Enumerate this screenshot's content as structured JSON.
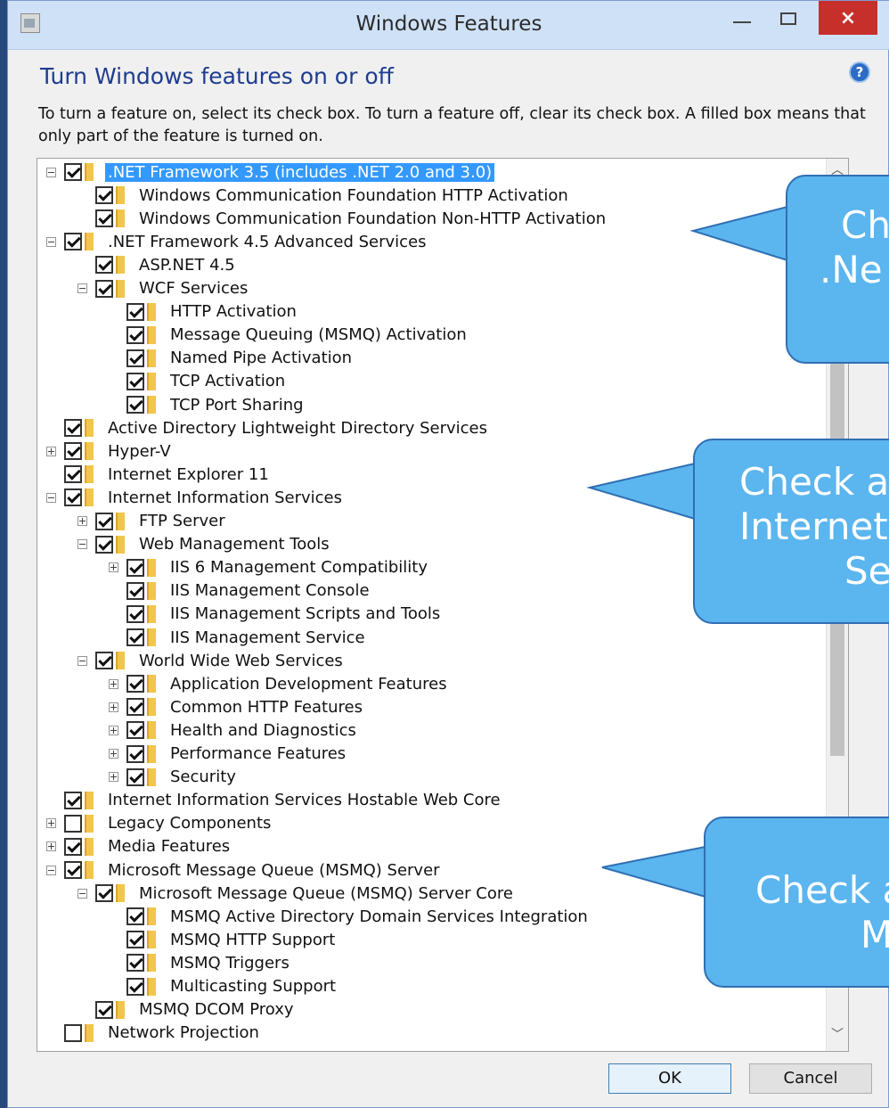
{
  "window": {
    "title": "Windows Features",
    "close_glyph": "×"
  },
  "heading": "Turn Windows features on or off",
  "help_glyph": "?",
  "description": "To turn a feature on, select its check box. To turn a feature off, clear its check box. A filled box means that only part of the feature is turned on.",
  "features": [
    {
      "label": ".NET Framework 3.5 (includes .NET 2.0 and 3.0)",
      "level": 0,
      "expander": "minus",
      "checked": true,
      "selected": true
    },
    {
      "label": "Windows Communication Foundation HTTP Activation",
      "level": 1,
      "expander": "none",
      "checked": true
    },
    {
      "label": "Windows Communication Foundation Non-HTTP Activation",
      "level": 1,
      "expander": "none",
      "checked": true
    },
    {
      "label": ".NET Framework 4.5 Advanced Services",
      "level": 0,
      "expander": "minus",
      "checked": true
    },
    {
      "label": "ASP.NET 4.5",
      "level": 1,
      "expander": "none",
      "checked": true
    },
    {
      "label": "WCF Services",
      "level": 1,
      "expander": "minus",
      "checked": true
    },
    {
      "label": "HTTP Activation",
      "level": 2,
      "expander": "none",
      "checked": true
    },
    {
      "label": "Message Queuing (MSMQ) Activation",
      "level": 2,
      "expander": "none",
      "checked": true
    },
    {
      "label": "Named Pipe Activation",
      "level": 2,
      "expander": "none",
      "checked": true
    },
    {
      "label": "TCP Activation",
      "level": 2,
      "expander": "none",
      "checked": true
    },
    {
      "label": "TCP Port Sharing",
      "level": 2,
      "expander": "none",
      "checked": true
    },
    {
      "label": "Active Directory Lightweight Directory Services",
      "level": 0,
      "expander": "none",
      "checked": true
    },
    {
      "label": "Hyper-V",
      "level": 0,
      "expander": "plus",
      "checked": true
    },
    {
      "label": "Internet Explorer 11",
      "level": 0,
      "expander": "none",
      "checked": true
    },
    {
      "label": "Internet Information Services",
      "level": 0,
      "expander": "minus",
      "checked": true
    },
    {
      "label": "FTP Server",
      "level": 1,
      "expander": "plus",
      "checked": true
    },
    {
      "label": "Web Management Tools",
      "level": 1,
      "expander": "minus",
      "checked": true
    },
    {
      "label": "IIS 6 Management Compatibility",
      "level": 2,
      "expander": "plus",
      "checked": true
    },
    {
      "label": "IIS Management Console",
      "level": 2,
      "expander": "none",
      "checked": true
    },
    {
      "label": "IIS Management Scripts and Tools",
      "level": 2,
      "expander": "none",
      "checked": true
    },
    {
      "label": "IIS Management Service",
      "level": 2,
      "expander": "none",
      "checked": true
    },
    {
      "label": "World Wide Web Services",
      "level": 1,
      "expander": "minus",
      "checked": true
    },
    {
      "label": "Application Development Features",
      "level": 2,
      "expander": "plus",
      "checked": true
    },
    {
      "label": "Common HTTP Features",
      "level": 2,
      "expander": "plus",
      "checked": true
    },
    {
      "label": "Health and Diagnostics",
      "level": 2,
      "expander": "plus",
      "checked": true
    },
    {
      "label": "Performance Features",
      "level": 2,
      "expander": "plus",
      "checked": true
    },
    {
      "label": "Security",
      "level": 2,
      "expander": "plus",
      "checked": true
    },
    {
      "label": "Internet Information Services Hostable Web Core",
      "level": 0,
      "expander": "none",
      "checked": true
    },
    {
      "label": "Legacy Components",
      "level": 0,
      "expander": "plus",
      "checked": false
    },
    {
      "label": "Media Features",
      "level": 0,
      "expander": "plus",
      "checked": true
    },
    {
      "label": "Microsoft Message Queue (MSMQ) Server",
      "level": 0,
      "expander": "minus",
      "checked": true
    },
    {
      "label": "Microsoft Message Queue (MSMQ) Server Core",
      "level": 1,
      "expander": "minus",
      "checked": true
    },
    {
      "label": "MSMQ Active Directory Domain Services Integration",
      "level": 2,
      "expander": "none",
      "checked": true
    },
    {
      "label": "MSMQ HTTP Support",
      "level": 2,
      "expander": "none",
      "checked": true
    },
    {
      "label": "MSMQ Triggers",
      "level": 2,
      "expander": "none",
      "checked": true
    },
    {
      "label": "Multicasting Support",
      "level": 2,
      "expander": "none",
      "checked": true
    },
    {
      "label": "MSMQ DCOM Proxy",
      "level": 1,
      "expander": "none",
      "checked": true
    },
    {
      "label": "Network Projection",
      "level": 0,
      "expander": "none",
      "checked": false
    }
  ],
  "buttons": {
    "ok": "OK",
    "cancel": "Cancel"
  },
  "callouts": [
    {
      "lines": [
        "Ch",
        ".Ne"
      ]
    },
    {
      "lines": [
        "Check al",
        "Internet",
        "Se"
      ]
    },
    {
      "lines": [
        "Check a",
        "M"
      ]
    }
  ],
  "colors": {
    "selection": "#3399ff",
    "callout_fill": "#5bb5ee",
    "heading": "#1e3c8f",
    "close_button": "#c7302a"
  }
}
